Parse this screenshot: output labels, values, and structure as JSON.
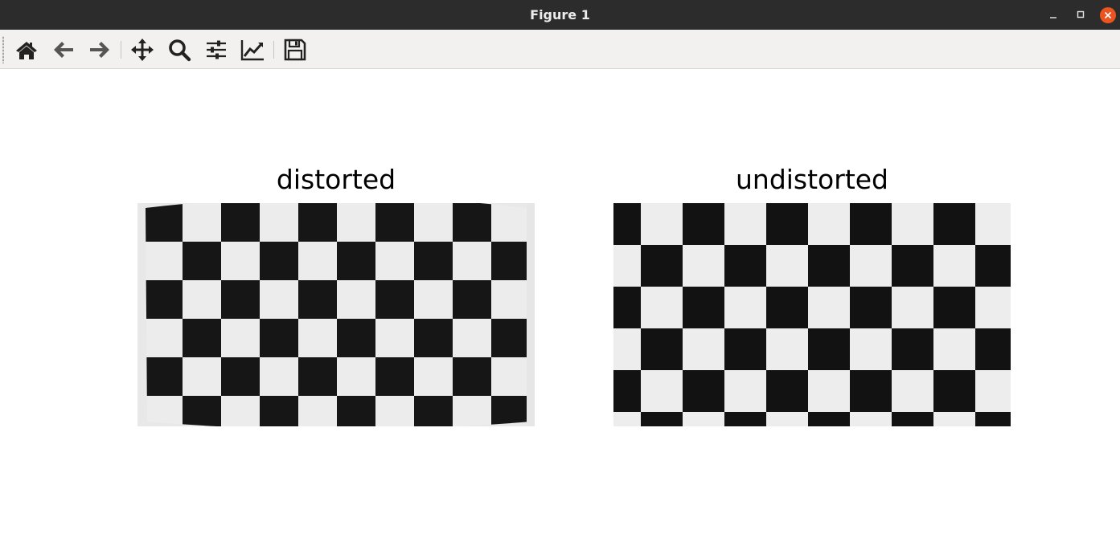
{
  "window": {
    "title": "Figure 1",
    "controls": [
      "minimize-icon",
      "maximize-icon",
      "close-icon"
    ],
    "close_color": "#e95420"
  },
  "toolbar": {
    "buttons": [
      "home-icon",
      "back-arrow-icon",
      "forward-arrow-icon",
      "pan-move-icon",
      "zoom-magnifier-icon",
      "configure-subplots-icon",
      "edit-axis-icon",
      "save-floppy-icon"
    ]
  },
  "figure": {
    "left_title": "distorted",
    "right_title": "undistorted"
  }
}
